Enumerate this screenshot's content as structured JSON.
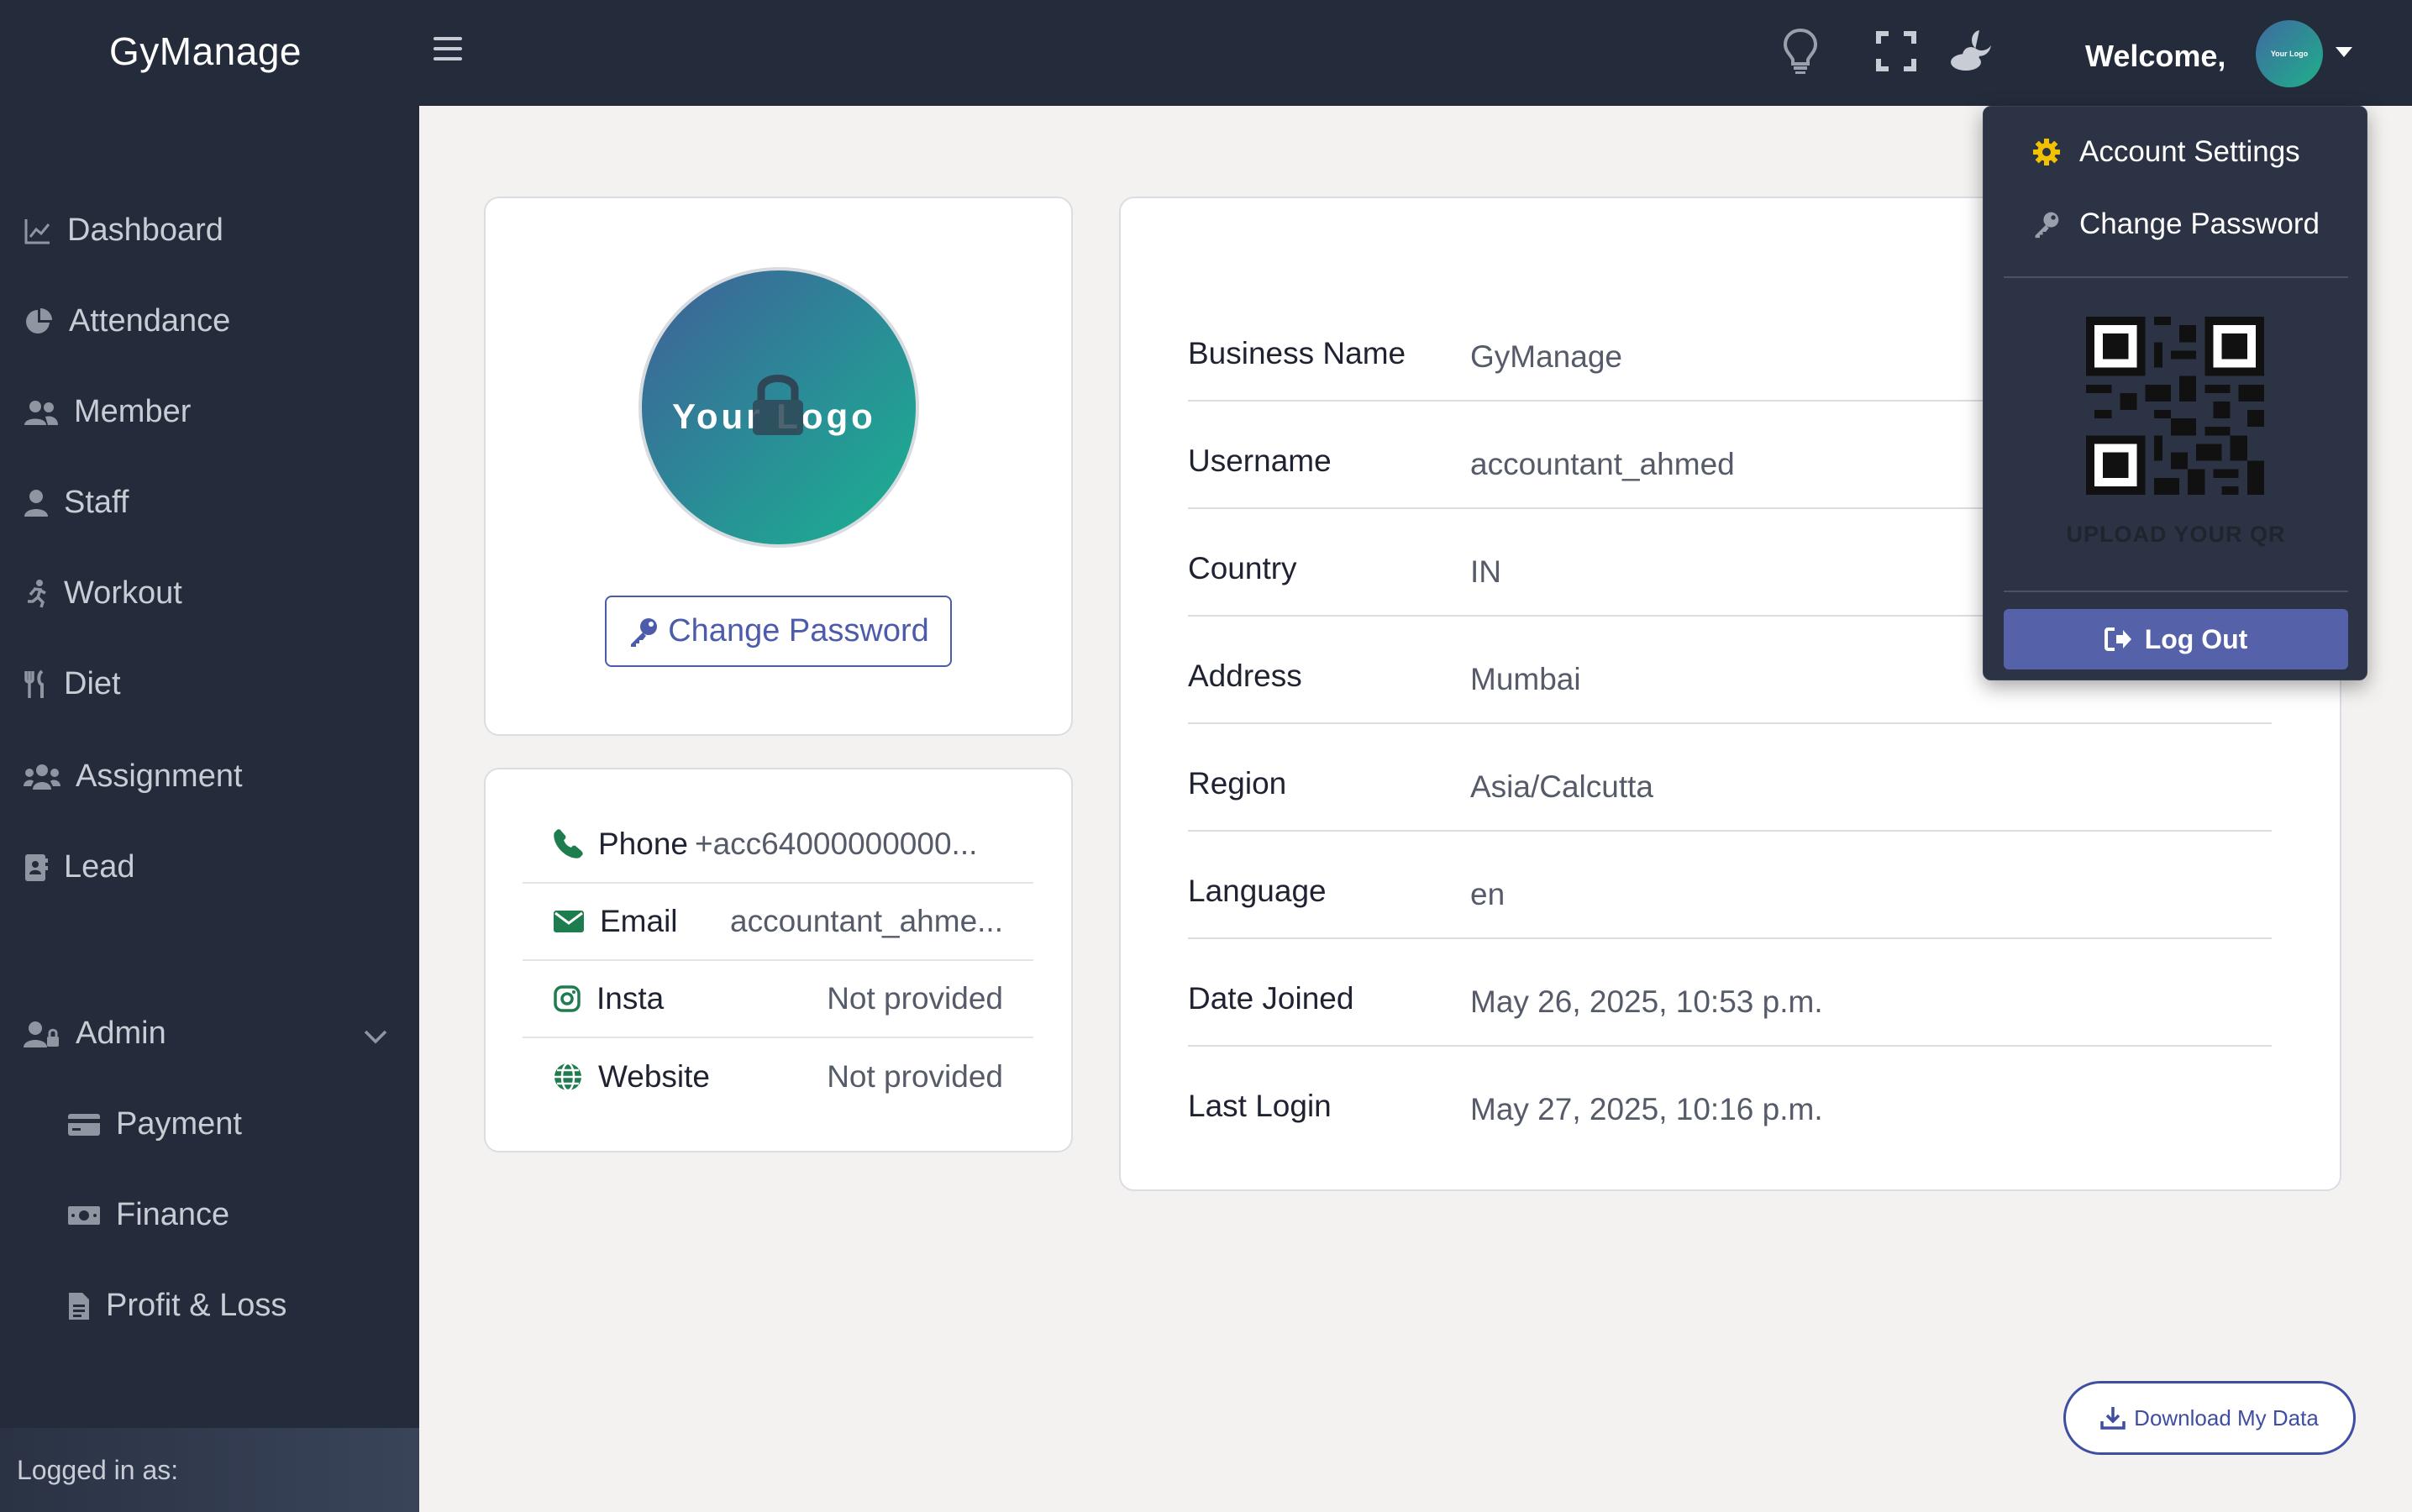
{
  "app": {
    "brand": "GyManage"
  },
  "topbar": {
    "welcome": "Welcome,",
    "avatar_text": "Your Logo",
    "icons": [
      "lightbulb-icon",
      "fullscreen-icon",
      "moon-cloud-icon"
    ]
  },
  "sidebar": {
    "items": [
      {
        "label": "Dashboard",
        "icon": "chart-line-icon"
      },
      {
        "label": "Attendance",
        "icon": "pie-chart-icon"
      },
      {
        "label": "Member",
        "icon": "users-icon"
      },
      {
        "label": "Staff",
        "icon": "user-tie-icon"
      },
      {
        "label": "Workout",
        "icon": "running-icon"
      },
      {
        "label": "Diet",
        "icon": "utensils-icon"
      },
      {
        "label": "Assignment",
        "icon": "user-group-icon"
      },
      {
        "label": "Lead",
        "icon": "address-book-icon"
      },
      {
        "label": "Admin",
        "icon": "user-lock-icon"
      },
      {
        "label": "Payment",
        "icon": "credit-card-icon"
      },
      {
        "label": "Finance",
        "icon": "money-bill-icon"
      },
      {
        "label": "Profit & Loss",
        "icon": "file-icon"
      }
    ],
    "logged_in_as": "Logged in as:"
  },
  "profile": {
    "logo_text": "Your Logo",
    "change_password": "Change Password"
  },
  "contact": {
    "phone_label": "Phone",
    "phone_value": "+acc64000000000...",
    "email_label": "Email",
    "email_value": "accountant_ahme...",
    "insta_label": "Insta",
    "insta_value": "Not provided",
    "website_label": "Website",
    "website_value": "Not provided"
  },
  "details": {
    "rows": [
      {
        "label": "Business Name",
        "value": "GyManage"
      },
      {
        "label": "Username",
        "value": "accountant_ahmed"
      },
      {
        "label": "Country",
        "value": "IN"
      },
      {
        "label": "Address",
        "value": "Mumbai"
      },
      {
        "label": "Region",
        "value": "Asia/Calcutta"
      },
      {
        "label": "Language",
        "value": "en"
      },
      {
        "label": "Date Joined",
        "value": "May 26, 2025, 10:53 p.m."
      },
      {
        "label": "Last Login",
        "value": "May 27, 2025, 10:16 p.m."
      }
    ]
  },
  "dropdown": {
    "account_settings": "Account Settings",
    "change_password": "Change Password",
    "qr_caption": "UPLOAD YOUR QR",
    "logout": "Log Out"
  },
  "download_button": "Download My Data",
  "colors": {
    "sidebar_bg": "#242b3a",
    "accent": "#4d5caa",
    "contact_green": "#1e7d4f",
    "gear_yellow": "#f2c200"
  }
}
